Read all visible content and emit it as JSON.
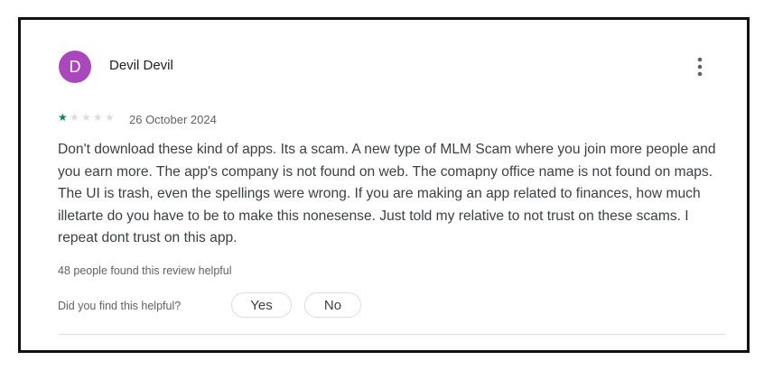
{
  "review": {
    "avatar_letter": "D",
    "avatar_color": "#ab47bc",
    "author_name": "Devil Devil",
    "more_options_icon": "more-vert-icon",
    "rating": 1,
    "max_rating": 5,
    "star_filled_color": "#01875f",
    "star_empty_color": "#dadce0",
    "date": "26 October 2024",
    "text": "Don't download these kind of apps. Its a scam. A new type of MLM Scam where you join more people and you earn more. The app's company is not found on web. The comapny office name is not found on maps. The UI is trash, even the spellings were wrong. If you are making an app related to finances, how much illetarte do you have to be to make this nonesense. Just told my relative to not trust on these scams. I repeat dont trust on this app.",
    "helpful_count_text": "48 people found this review helpful",
    "helpful_question": "Did you find this helpful?",
    "yes_label": "Yes",
    "no_label": "No"
  }
}
